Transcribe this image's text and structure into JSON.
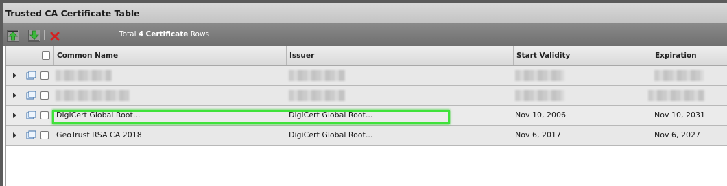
{
  "window": {
    "title": "Trusted CA Certificate Table"
  },
  "toolbar": {
    "import_icon": "green-up-arrow-icon",
    "export_icon": "green-down-arrow-icon",
    "delete_icon": "red-x-icon",
    "count_prefix": "Total",
    "count_value": "4",
    "count_unit": "Certificate",
    "count_suffix": "Rows"
  },
  "table": {
    "columns": [
      "Common Name",
      "Issuer",
      "Start Validity",
      "Expiration"
    ],
    "rows": [
      {
        "common_name": "",
        "issuer": "",
        "start": "",
        "expiration": "",
        "redacted": true
      },
      {
        "common_name": "",
        "issuer": "",
        "start": "",
        "expiration": "",
        "redacted": true
      },
      {
        "common_name": "DigiCert Global Root...",
        "issuer": "DigiCert Global Root...",
        "start": "Nov 10, 2006",
        "expiration": "Nov 10, 2031",
        "redacted": false
      },
      {
        "common_name": "GeoTrust RSA CA 2018",
        "issuer": "DigiCert Global Root...",
        "start": "Nov 6, 2017",
        "expiration": "Nov 6, 2027",
        "redacted": false
      }
    ]
  },
  "colors": {
    "highlight": "#3fe23a",
    "delete": "#d42020",
    "arrow": "#3cb83c"
  }
}
